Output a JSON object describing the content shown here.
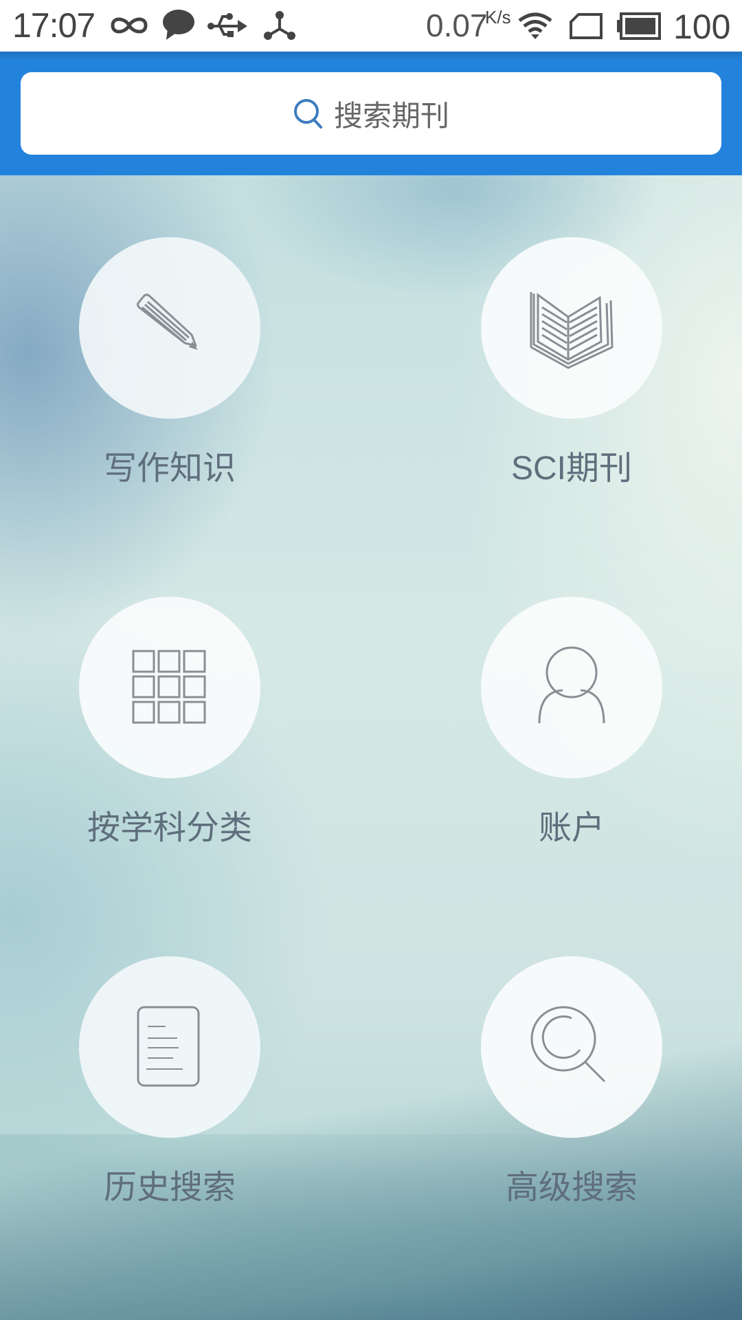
{
  "status_bar": {
    "time": "17:07",
    "icons_left": [
      "infinity-icon",
      "chat-bubble-icon",
      "usb-icon",
      "share-node-icon"
    ],
    "network_speed": "0.07",
    "network_speed_unit": "K/s",
    "icons_right": [
      "wifi-icon",
      "sim-card-icon",
      "battery-icon"
    ],
    "battery_percent": "100"
  },
  "header": {
    "search": {
      "placeholder": "搜索期刊",
      "value": "",
      "icon": "search-icon"
    },
    "accent_color": "#2383dc"
  },
  "menu": {
    "items": [
      {
        "id": "writing",
        "label": "写作知识",
        "icon": "pencil-icon"
      },
      {
        "id": "sci",
        "label": "SCI期刊",
        "icon": "open-book-icon"
      },
      {
        "id": "subject",
        "label": "按学科分类",
        "icon": "grid-icon"
      },
      {
        "id": "account",
        "label": "账户",
        "icon": "user-icon"
      },
      {
        "id": "history",
        "label": "历史搜索",
        "icon": "document-icon"
      },
      {
        "id": "advanced",
        "label": "高级搜索",
        "icon": "magnifier-icon"
      }
    ]
  },
  "colors": {
    "icon_stroke": "#8a8e94",
    "label_text": "#5f6e7c",
    "search_icon": "#3d7cc0"
  }
}
